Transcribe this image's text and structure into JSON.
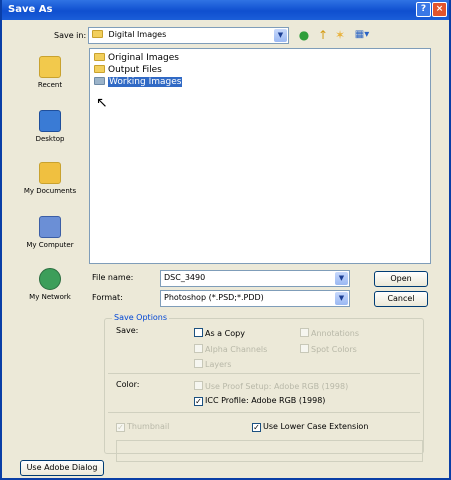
{
  "window": {
    "title": "Save As"
  },
  "toolbar": {
    "save_in_label": "Save in:",
    "save_in_value": "Digital Images"
  },
  "places": [
    {
      "label": "Recent",
      "icon": "recent-folder-icon",
      "color": "#f2c94c"
    },
    {
      "label": "Desktop",
      "icon": "desktop-icon",
      "color": "#3a7bd5"
    },
    {
      "label": "My Documents",
      "icon": "my-documents-icon",
      "color": "#f0c040"
    },
    {
      "label": "My Computer",
      "icon": "my-computer-icon",
      "color": "#6b8fd6"
    },
    {
      "label": "My Network",
      "icon": "my-network-icon",
      "color": "#3c9e5a"
    }
  ],
  "files": [
    {
      "name": "Original Images"
    },
    {
      "name": "Output Files"
    },
    {
      "name": "Working Images"
    }
  ],
  "form": {
    "file_name_label": "File name:",
    "file_name_value": "DSC_3490",
    "format_label": "Format:",
    "format_value": "Photoshop (*.PSD;*.PDD)",
    "open_label": "Open",
    "cancel_label": "Cancel"
  },
  "save_options": {
    "legend": "Save Options",
    "save_label": "Save:",
    "as_a_copy": "As a Copy",
    "annotations": "Annotations",
    "alpha_channels": "Alpha Channels",
    "spot_colors": "Spot Colors",
    "layers": "Layers",
    "color_label": "Color:",
    "use_proof_setup": "Use Proof Setup:  Adobe RGB (1998)",
    "icc_profile": "ICC Profile:  Adobe RGB (1998)",
    "thumbnail": "Thumbnail",
    "use_lower_case": "Use Lower Case Extension"
  },
  "bottom": {
    "use_adobe_dialog": "Use Adobe Dialog"
  }
}
